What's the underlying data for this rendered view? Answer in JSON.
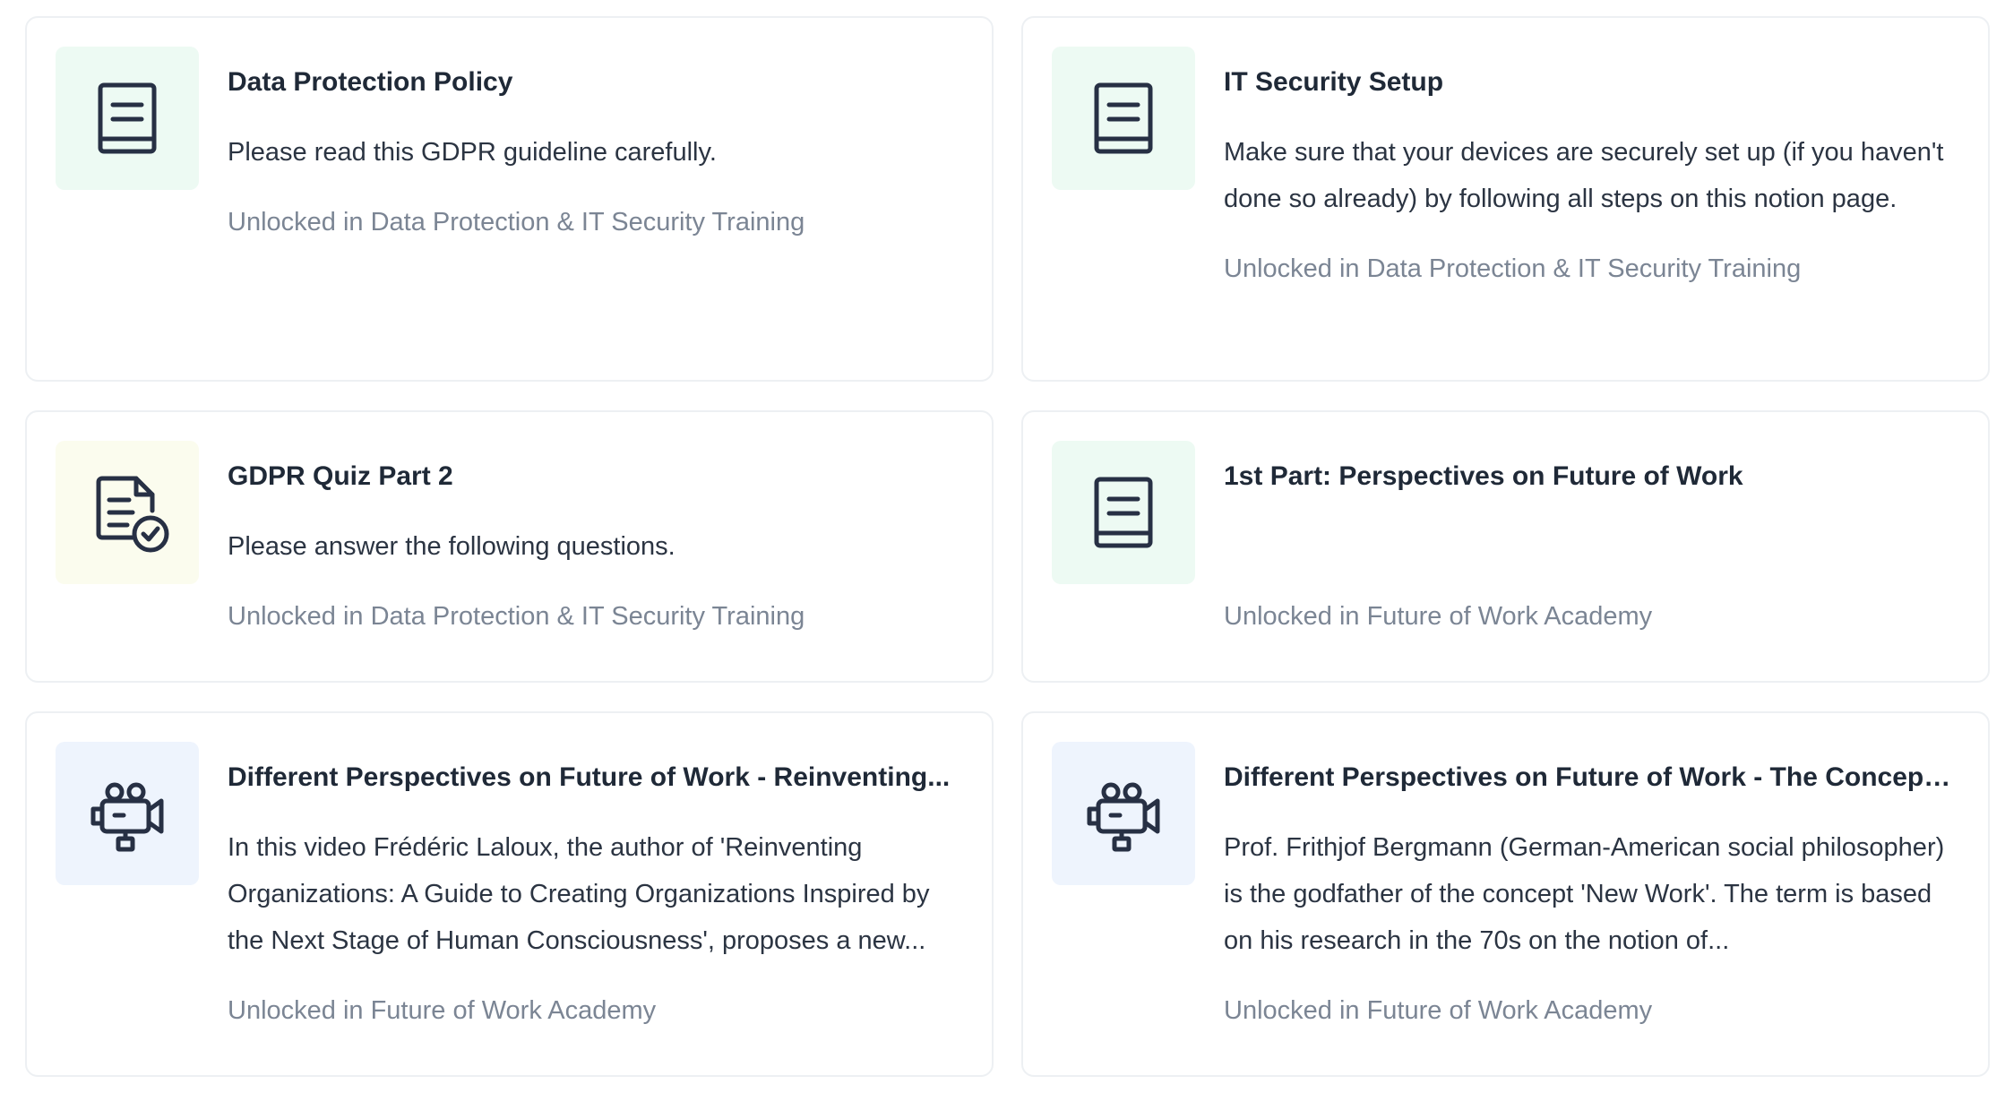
{
  "colors": {
    "icon_stroke": "#273044",
    "green_tint": "#edfaf3",
    "yellow_tint": "#fbfcee",
    "blue_tint": "#eef4fd",
    "border": "#edf0f3",
    "muted_text": "#7b8594"
  },
  "cards": [
    {
      "icon": "book-icon",
      "tint": "green",
      "title": "Data Protection Policy",
      "description": "Please read this GDPR guideline carefully.",
      "unlock": "Unlocked in Data Protection & IT Security Training"
    },
    {
      "icon": "book-icon",
      "tint": "green",
      "title": "IT Security Setup",
      "description": "Make sure that your devices are securely set up (if you haven't done so already) by following all steps on this notion page.",
      "unlock": "Unlocked in Data Protection & IT Security Training"
    },
    {
      "icon": "quiz-document-check-icon",
      "tint": "yellow",
      "title": "GDPR Quiz Part 2",
      "description": "Please answer the following questions.",
      "unlock": "Unlocked in Data Protection & IT Security Training"
    },
    {
      "icon": "book-icon",
      "tint": "green",
      "title": "1st Part: Perspectives on Future of Work",
      "description": "",
      "unlock": "Unlocked in Future of Work Academy"
    },
    {
      "icon": "video-camera-icon",
      "tint": "blue",
      "title": "Different Perspectives on Future of Work - Reinventing...",
      "description": "In this video Frédéric Laloux, the author of 'Reinventing Organizations: A Guide to Creating Organizations Inspired by the Next Stage of Human Consciousness', proposes a new...",
      "unlock": "Unlocked in Future of Work Academy"
    },
    {
      "icon": "video-camera-icon",
      "tint": "blue",
      "title": "Different Perspectives on Future of Work - The Concept of...",
      "description": "Prof. Frithjof Bergmann (German-American social philosopher) is the godfather of the concept 'New Work'. The term is based on his research in the 70s on the notion of...",
      "unlock": "Unlocked in Future of Work Academy"
    }
  ]
}
